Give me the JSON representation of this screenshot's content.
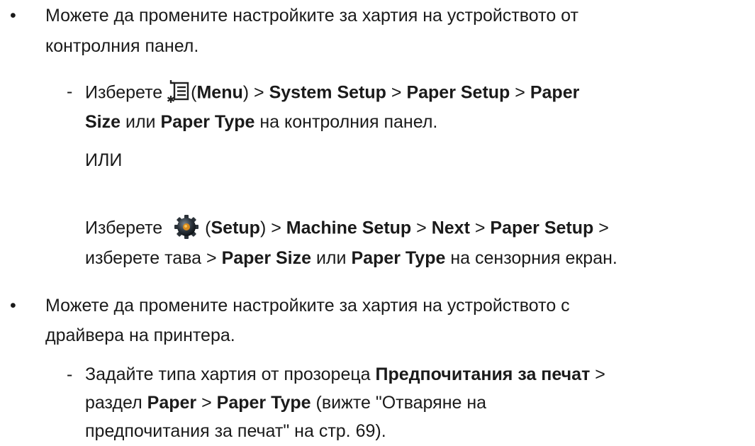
{
  "bullets": [
    "•",
    "•"
  ],
  "dashes": [
    "-",
    "-"
  ],
  "item1": {
    "line1": "Можете да промените настройките за хартия на устройството от",
    "line2": "контролния панел."
  },
  "sub1": {
    "l1_a": "Изберете",
    "l1_b": "(",
    "menu": "Menu",
    "l1_c": ") >",
    "system_setup": "System Setup",
    "gt1": ">",
    "paper_setup": "Paper Setup",
    "gt2": ">",
    "paper": "Paper",
    "size": "Size",
    "or1": "или",
    "paper_type": "Paper Type",
    "l2_end": "на контролния панел."
  },
  "or_text": "ИЛИ",
  "sub2": {
    "l1_a": "Изберете",
    "open_paren": "(",
    "setup": "Setup",
    "close_paren": ") >",
    "machine_setup": "Machine Setup",
    "gt1": ">",
    "next": "Next",
    "gt2": ">",
    "paper_setup": "Paper Setup",
    "gt3": ">",
    "l2_a": "изберете тава >",
    "paper_size": "Paper Size",
    "or1": "или",
    "paper_type": "Paper Type",
    "l2_end": "на сензорния екран."
  },
  "item2": {
    "line1": "Можете да промените настройките за хартия на устройството с",
    "line2": "драйвера на принтера."
  },
  "sub3": {
    "l1_a": "Задайте типа хартия от прозореца",
    "pref": "Предпочитания за печат",
    "gt1": ">",
    "l2_a": "раздел",
    "paper": "Paper",
    "gt2": ">",
    "paper_type": "Paper Type",
    "l2_b": "(вижте \"Отваряне на",
    "l3": "предпочитания за печат\" на стр. 69)."
  },
  "icons": [
    "menu-icon",
    "setup-gear-icon"
  ]
}
